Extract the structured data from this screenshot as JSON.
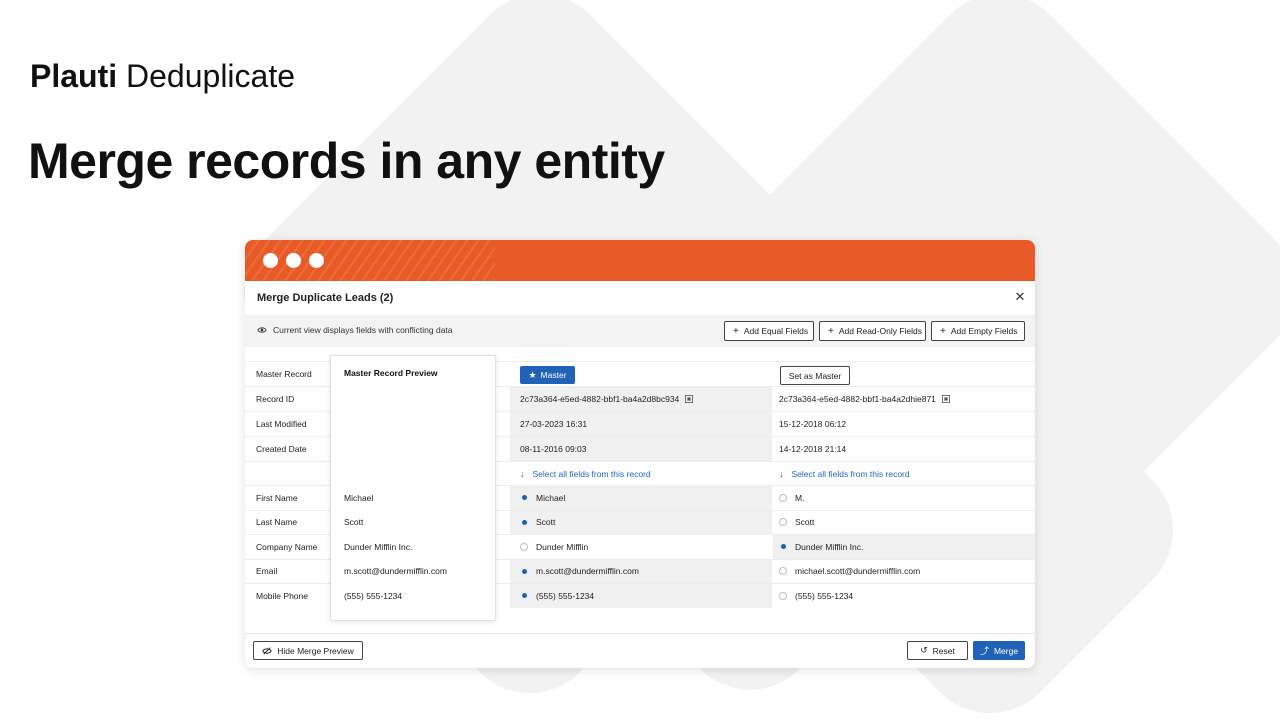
{
  "brand": {
    "bold": "Plauti",
    "rest": " Deduplicate"
  },
  "headline": "Merge records in any entity",
  "dialog": {
    "title": "Merge Duplicate Leads (2)",
    "close_icon": "close-icon",
    "info_text": "Current view displays fields with conflicting data",
    "toolbar": {
      "add_equal": "Add Equal Fields",
      "add_readonly": "Add Read-Only Fields",
      "add_empty": "Add Empty Fields"
    },
    "master_button": "Master",
    "set_master_button": "Set as Master",
    "preview_title": "Master Record Preview",
    "select_all": "Select all fields from this record",
    "meta_rows": [
      {
        "label": "Master Record"
      },
      {
        "label": "Record ID",
        "rec1": "2c73a364-e5ed-4882-bbf1-ba4a2d8bc934",
        "rec2": "2c73a364-e5ed-4882-bbf1-ba4a2dhie871"
      },
      {
        "label": "Last Modified",
        "rec1": "27-03-2023 16:31",
        "rec2": "15-12-2018 06:12"
      },
      {
        "label": "Created Date",
        "rec1": "08-11-2016 09:03",
        "rec2": "14-12-2018 21:14"
      }
    ],
    "field_rows": [
      {
        "label": "First Name",
        "preview": "Michael",
        "rec1": "Michael",
        "rec1_selected": true,
        "rec2": "M.",
        "rec2_selected": false
      },
      {
        "label": "Last Name",
        "preview": "Scott",
        "rec1": "Scott",
        "rec1_selected": true,
        "rec2": "Scott",
        "rec2_selected": false
      },
      {
        "label": "Company Name",
        "preview": "Dunder Mifflin Inc.",
        "rec1": "Dunder Mifflin",
        "rec1_selected": false,
        "rec2": "Dunder Mifflin Inc.",
        "rec2_selected": true
      },
      {
        "label": "Email",
        "preview": "m.scott@dundermifflin.com",
        "rec1": "m.scott@dundermifflin.com",
        "rec1_selected": true,
        "rec2": "michael.scott@dundermifflin.com",
        "rec2_selected": false
      },
      {
        "label": "Mobile Phone",
        "preview": "(555) 555-1234",
        "rec1": "(555) 555-1234",
        "rec1_selected": true,
        "rec2": "(555) 555-1234",
        "rec2_selected": false
      }
    ],
    "footer": {
      "hide_preview": "Hide Merge Preview",
      "reset": "Reset",
      "merge": "Merge"
    }
  },
  "colors": {
    "titlebar": "#e95b26",
    "primary": "#1f62b7",
    "link": "#2165c4"
  }
}
